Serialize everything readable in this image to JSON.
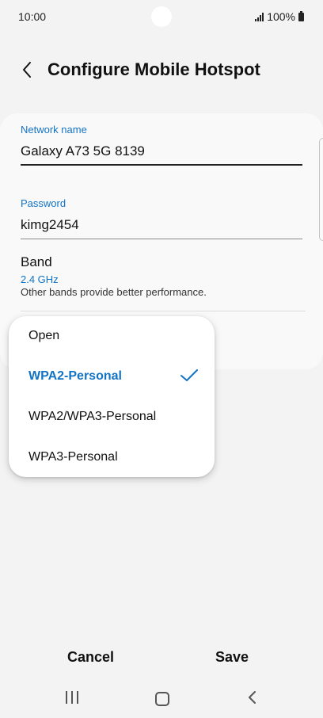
{
  "status_bar": {
    "time": "10:00",
    "battery_text": "100%",
    "icons": [
      "signal-icon",
      "battery-icon"
    ]
  },
  "header": {
    "title": "Configure Mobile Hotspot",
    "back_icon": "chevron-left-icon"
  },
  "form": {
    "network_name_label": "Network name",
    "network_name_value": "Galaxy A73 5G 8139",
    "password_label": "Password",
    "password_value": "kimg2454",
    "band_title": "Band",
    "band_value": "2.4 GHz",
    "band_description": "Other bands provide better performance."
  },
  "security_dropdown": {
    "options": [
      "Open",
      "WPA2-Personal",
      "WPA2/WPA3-Personal",
      "WPA3-Personal"
    ],
    "selected": "WPA2-Personal",
    "selected_icon": "check-icon"
  },
  "footer": {
    "cancel_label": "Cancel",
    "save_label": "Save"
  },
  "nav_bar": {
    "icons": [
      "recent-apps-icon",
      "home-icon",
      "back-icon"
    ]
  },
  "colors": {
    "accent": "#1273c5",
    "background": "#f3f3f3",
    "card": "#f9f9f9",
    "text": "#111111"
  }
}
